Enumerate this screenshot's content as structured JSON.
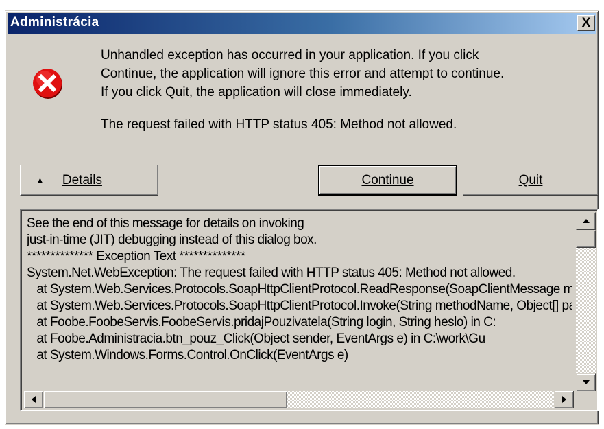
{
  "window": {
    "title": "Administrácia",
    "close_label": "X"
  },
  "icon": "error-x-icon",
  "message": {
    "lines": [
      "Unhandled exception has occurred in your application. If you click",
      "Continue, the application will ignore this error and attempt to continue.",
      "If you click Quit, the application will close immediately."
    ],
    "status": "The request failed with HTTP status 405: Method not allowed."
  },
  "buttons": {
    "details_label": "Details",
    "continue_label": "Continue",
    "quit_label": "Quit"
  },
  "details_text": [
    "See the end of this message for details on invoking",
    "just-in-time (JIT) debugging instead of this dialog box.",
    "",
    "************** Exception Text **************",
    "System.Net.WebException: The request failed with HTTP status 405: Method not allowed.",
    "   at System.Web.Services.Protocols.SoapHttpClientProtocol.ReadResponse(SoapClientMessage message, WebResponse response, Stream responseStream, Boolean asyncCall)",
    "   at System.Web.Services.Protocols.SoapHttpClientProtocol.Invoke(String methodName, Object[] parameters)",
    "   at Foobe.FoobeServis.FoobeServis.pridajPouzivatela(String login, String heslo) in C:",
    "   at Foobe.Administracia.btn_pouz_Click(Object sender, EventArgs e) in C:\\work\\Gu",
    "   at System.Windows.Forms.Control.OnClick(EventArgs e)"
  ],
  "colors": {
    "titlebar_start": "#0a246a",
    "titlebar_end": "#a6caf0",
    "face": "#d4d0c8",
    "error_red": "#e01010"
  }
}
